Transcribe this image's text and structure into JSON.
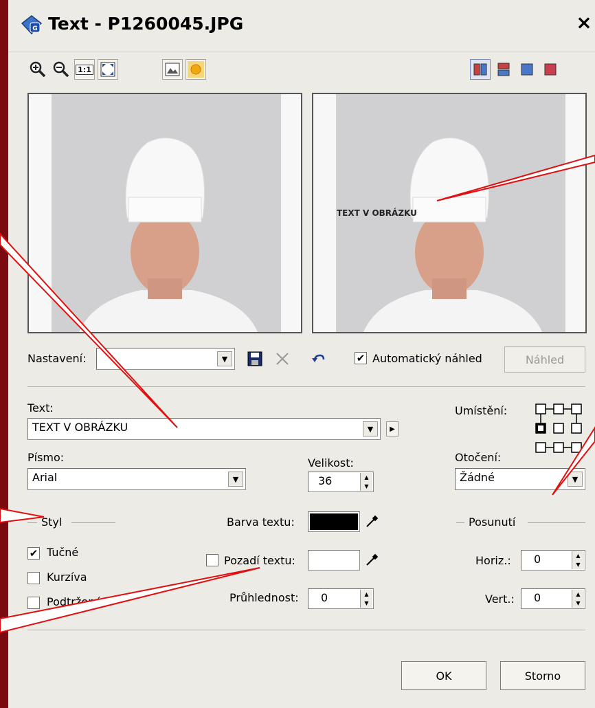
{
  "window": {
    "title": "Text - P1260045.JPG",
    "close": "×"
  },
  "toolbar": {
    "left": [
      "zoom-in-icon",
      "zoom-out-icon",
      "actual-size-icon",
      "fit-window-icon",
      "image-icon",
      "sun-icon"
    ],
    "right": [
      "split-vertical-icon",
      "split-horizontal-icon",
      "before-icon",
      "after-icon"
    ],
    "actual_size_label": "1:1"
  },
  "preview": {
    "overlay_text": "TEXT V OBRÁZKU"
  },
  "settings": {
    "label": "Nastavení:",
    "value": "",
    "auto_preview_label": "Automatický náhled",
    "auto_preview_checked": true,
    "preview_button": "Náhled"
  },
  "text": {
    "label": "Text:",
    "value": "TEXT V OBRÁZKU"
  },
  "placement": {
    "label": "Umístění:"
  },
  "font": {
    "label": "Písmo:",
    "value": "Arial"
  },
  "size": {
    "label": "Velikost:",
    "value": "36"
  },
  "rotation": {
    "label": "Otočení:",
    "value": "Žádné"
  },
  "style": {
    "group_label": "Styl",
    "bold": {
      "label": "Tučné",
      "checked": true
    },
    "italic": {
      "label": "Kurzíva",
      "checked": false
    },
    "underline": {
      "label": "Podtržené",
      "checked": false
    }
  },
  "colors": {
    "text_color_label": "Barva textu:",
    "text_color": "#000000",
    "background_label": "Pozadí textu:",
    "background_color": "#ffffff",
    "opacity_label": "Průhlednost:",
    "opacity_value": "0"
  },
  "offset": {
    "group_label": "Posunutí",
    "horiz_label": "Horiz.:",
    "horiz_value": "0",
    "vert_label": "Vert.:",
    "vert_value": "0"
  },
  "buttons": {
    "ok": "OK",
    "cancel": "Storno"
  },
  "annotation_color": "#e01010"
}
